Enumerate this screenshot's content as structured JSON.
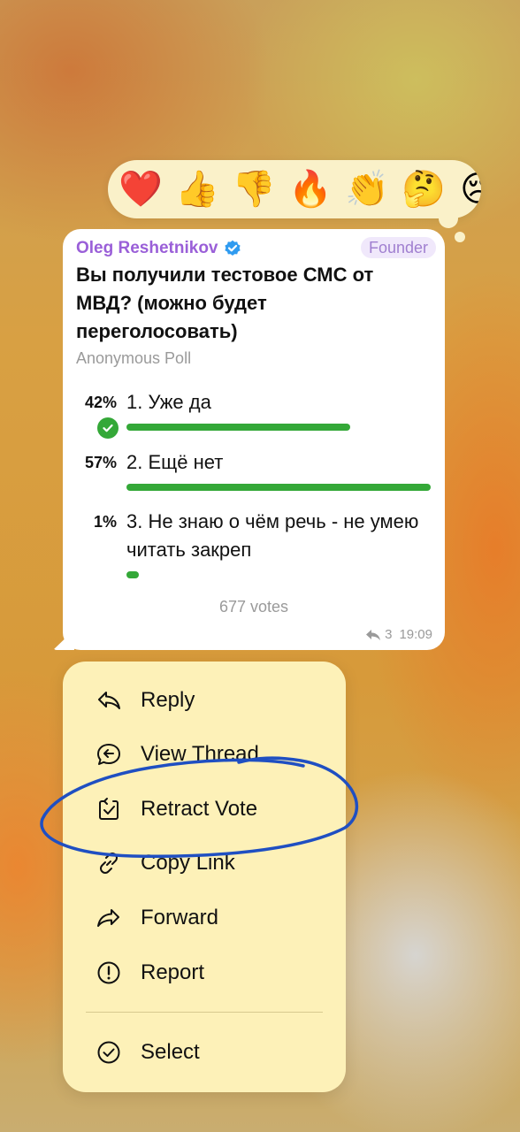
{
  "reactions": [
    {
      "emoji": "❤️",
      "name": "heart"
    },
    {
      "emoji": "👍",
      "name": "thumbs-up"
    },
    {
      "emoji": "👎",
      "name": "thumbs-down"
    },
    {
      "emoji": "🔥",
      "name": "fire"
    },
    {
      "emoji": "👏",
      "name": "clapping"
    },
    {
      "emoji": "🤔",
      "name": "thinking"
    },
    {
      "emoji": "😢",
      "name": "crying"
    }
  ],
  "message": {
    "author": "Oleg Reshetnikov",
    "role": "Founder",
    "question": "Вы получили тестовое СМС от МВД? (можно будет переголосовать)",
    "poll_type": "Anonymous Poll",
    "options": [
      {
        "percent": "42%",
        "text": "1. Уже да",
        "fraction": 0.42,
        "chosen": true
      },
      {
        "percent": "57%",
        "text": "2. Ещё нет",
        "fraction": 0.57,
        "chosen": false
      },
      {
        "percent": "1%",
        "text": "3. Не знаю о чём речь - не умею читать закреп",
        "fraction": 0.01,
        "chosen": false
      }
    ],
    "votes": "677 votes",
    "replies": "3",
    "time": "19:09"
  },
  "menu": {
    "items": [
      {
        "label": "Reply",
        "icon": "reply-icon"
      },
      {
        "label": "View Thread",
        "icon": "thread-icon"
      },
      {
        "label": "Retract Vote",
        "icon": "retract-vote-icon"
      },
      {
        "label": "Copy Link",
        "icon": "link-icon"
      },
      {
        "label": "Forward",
        "icon": "forward-icon"
      },
      {
        "label": "Report",
        "icon": "report-icon"
      }
    ],
    "select_label": "Select"
  },
  "colors": {
    "accent_green": "#34a838",
    "author_purple": "#9a5fd8",
    "annotation_blue": "#1f4fc2"
  }
}
